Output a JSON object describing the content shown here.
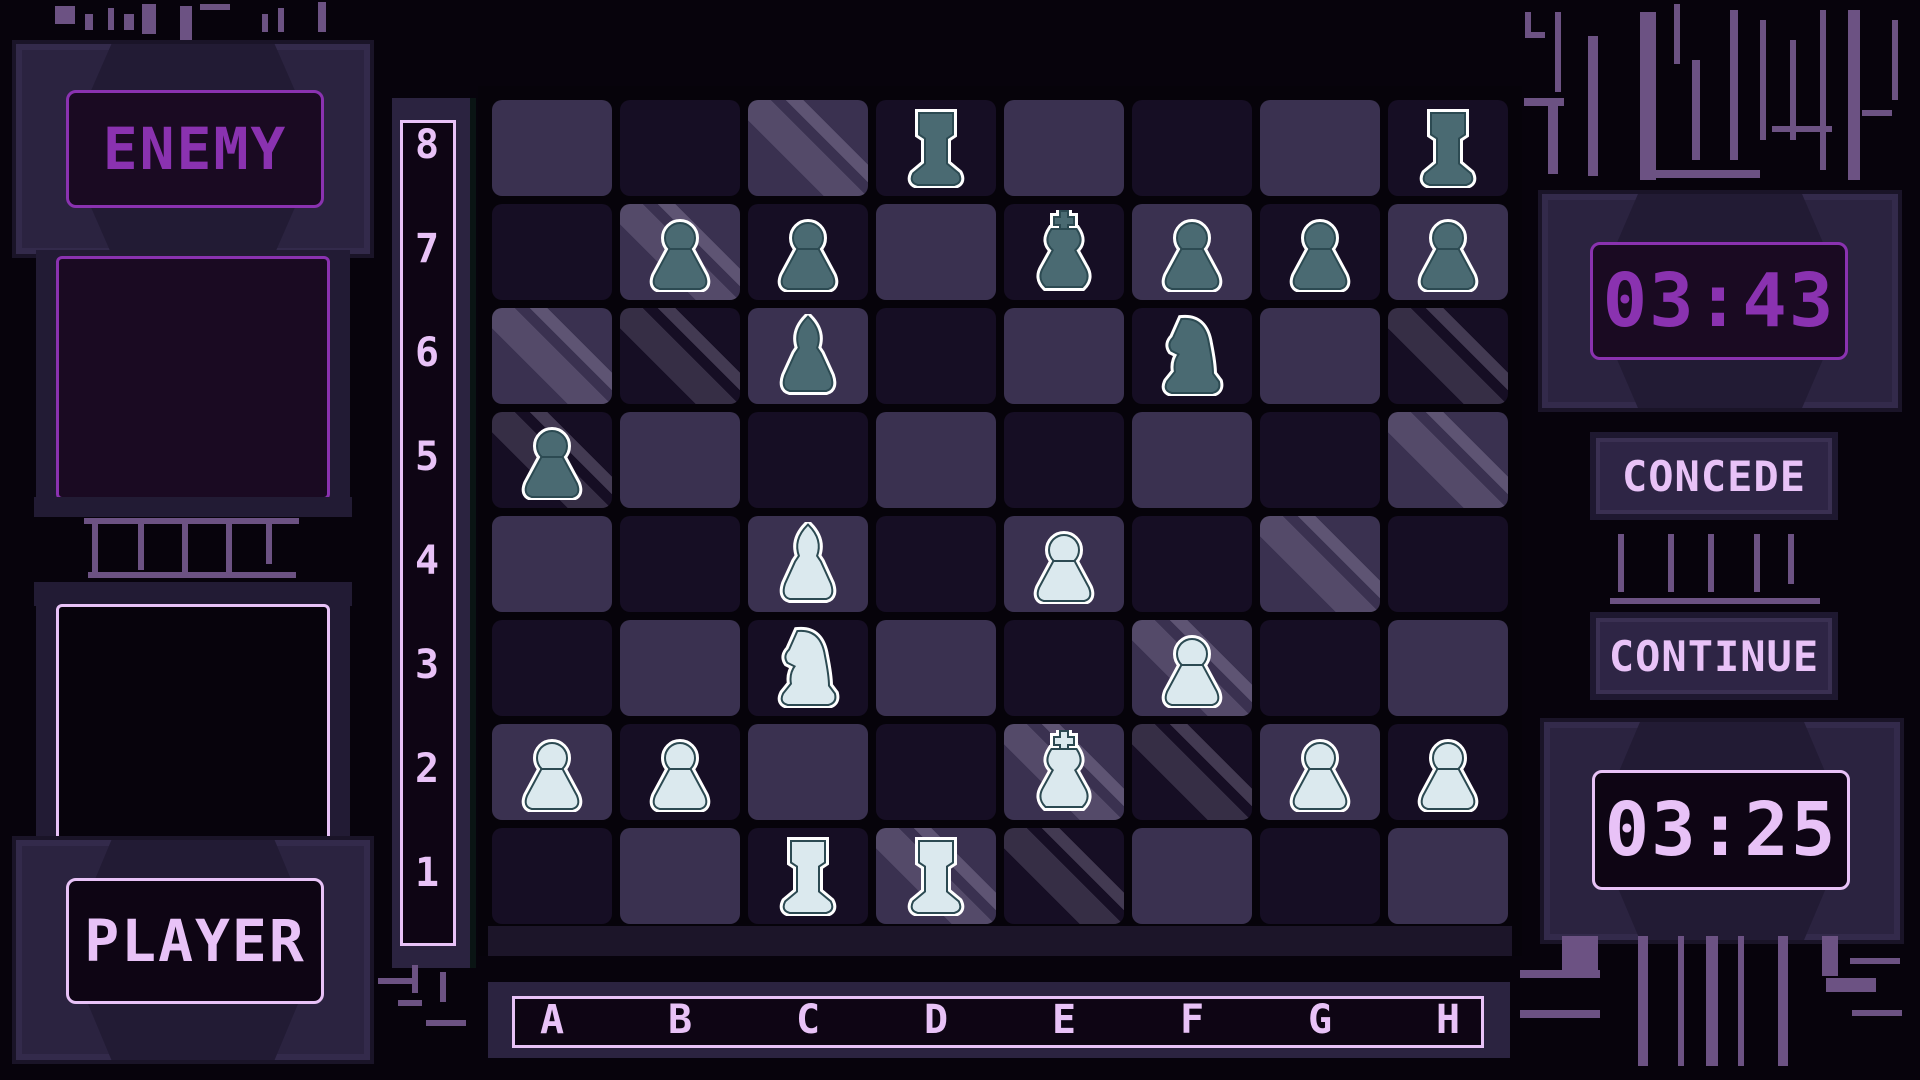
{
  "left_panel": {
    "enemy_label": "ENEMY",
    "player_label": "PLAYER"
  },
  "right_panel": {
    "enemy_timer": "03:43",
    "player_timer": "03:25",
    "concede_label": "CONCEDE",
    "continue_label": "CONTINUE"
  },
  "board": {
    "files": [
      "A",
      "B",
      "C",
      "D",
      "E",
      "F",
      "G",
      "H"
    ],
    "ranks": [
      "8",
      "7",
      "6",
      "5",
      "4",
      "3",
      "2",
      "1"
    ],
    "highlighted_squares": [
      "C8",
      "B7",
      "A6",
      "B6",
      "A5",
      "H6",
      "H5",
      "G4",
      "F3",
      "F2",
      "E2",
      "E1",
      "D1"
    ],
    "pieces": [
      {
        "square": "D8",
        "type": "rook",
        "color": "black"
      },
      {
        "square": "H8",
        "type": "rook",
        "color": "black"
      },
      {
        "square": "B7",
        "type": "pawn",
        "color": "black"
      },
      {
        "square": "C7",
        "type": "pawn",
        "color": "black"
      },
      {
        "square": "E7",
        "type": "king",
        "color": "black"
      },
      {
        "square": "F7",
        "type": "pawn",
        "color": "black"
      },
      {
        "square": "G7",
        "type": "pawn",
        "color": "black"
      },
      {
        "square": "H7",
        "type": "pawn",
        "color": "black"
      },
      {
        "square": "C6",
        "type": "bishop",
        "color": "black"
      },
      {
        "square": "F6",
        "type": "knight",
        "color": "black"
      },
      {
        "square": "A5",
        "type": "pawn",
        "color": "black"
      },
      {
        "square": "C4",
        "type": "bishop",
        "color": "white"
      },
      {
        "square": "E4",
        "type": "pawn",
        "color": "white"
      },
      {
        "square": "C3",
        "type": "knight",
        "color": "white"
      },
      {
        "square": "F3",
        "type": "pawn",
        "color": "white"
      },
      {
        "square": "A2",
        "type": "pawn",
        "color": "white"
      },
      {
        "square": "B2",
        "type": "pawn",
        "color": "white"
      },
      {
        "square": "E2",
        "type": "king",
        "color": "white"
      },
      {
        "square": "G2",
        "type": "pawn",
        "color": "white"
      },
      {
        "square": "H2",
        "type": "pawn",
        "color": "white"
      },
      {
        "square": "C1",
        "type": "rook",
        "color": "white"
      },
      {
        "square": "D1",
        "type": "rook",
        "color": "white"
      }
    ]
  },
  "colors": {
    "enemy_accent": "#8a32b0",
    "player_accent": "#e8c2f7",
    "light_square": "#3a3150",
    "dark_square": "#160e24",
    "black_piece_fill": "#4a6a72",
    "white_piece_fill": "#dbe9ee",
    "piece_outline": "#2c4a52"
  }
}
